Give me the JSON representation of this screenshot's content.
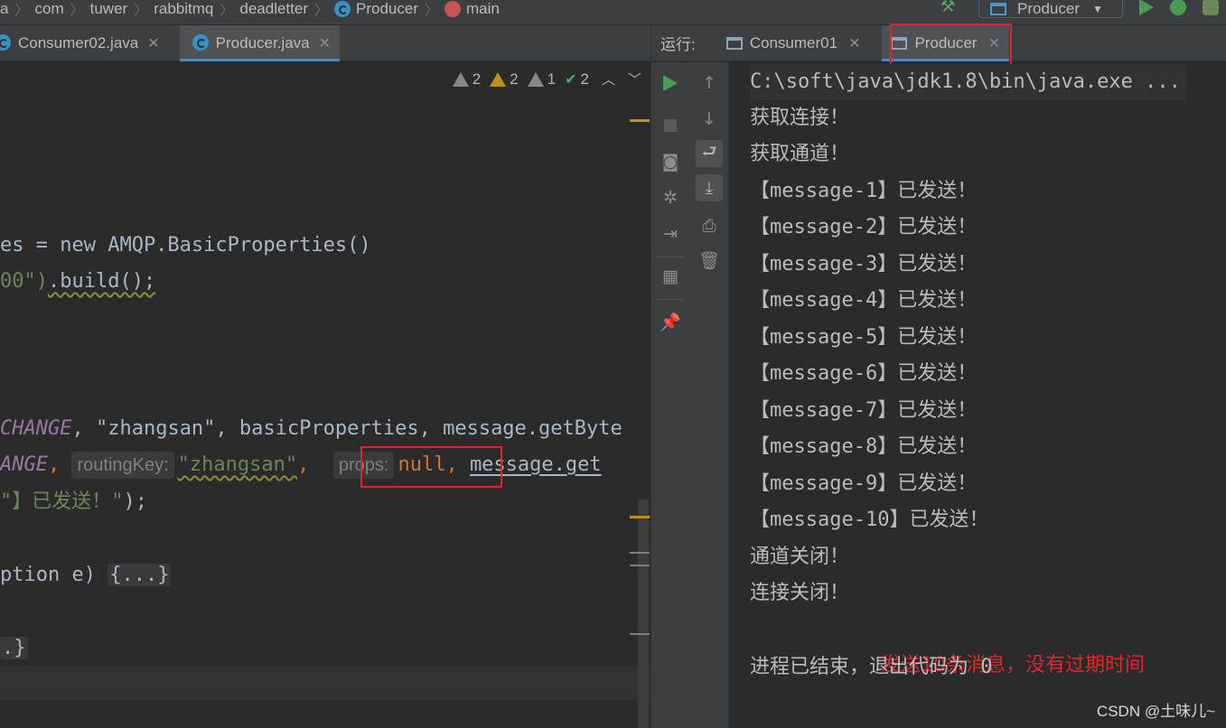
{
  "breadcrumb": {
    "items": [
      "a",
      "com",
      "tuwer",
      "rabbitmq",
      "deadletter",
      "Producer",
      "main"
    ]
  },
  "run_config": {
    "label": "Producer"
  },
  "editor": {
    "tabs": [
      {
        "label": "Consumer02.java",
        "active": false
      },
      {
        "label": "Producer.java",
        "active": true
      }
    ],
    "inspections": [
      {
        "kind": "warning",
        "count": "2"
      },
      {
        "kind": "warning",
        "count": "2"
      },
      {
        "kind": "weak-warning",
        "count": "1"
      },
      {
        "kind": "ok",
        "count": "2"
      }
    ],
    "code": {
      "line1": "es = new AMQP.BasicProperties()",
      "line2a": "00\")",
      "line2b": ".build();",
      "line3_const": "CHANGE",
      "line3_rest": ", \"zhangsan\", basicProperties, message.getByte",
      "line4_const": "ANGE",
      "line4_comma": ", ",
      "line4_hint1": "routingKey:",
      "line4_str": "\"zhangsan\"",
      "line4_comma2": ",  ",
      "line4_hint2": "props:",
      "line4_null": "null",
      "line4_comma3": ",",
      "line4_rest": "message.get",
      "line5_str": "\"】已发送！\"",
      "line5_rest": ");",
      "line6_a": "ption e) ",
      "line6_fold": "{...}",
      "line7": ".}"
    }
  },
  "run_panel": {
    "label": "运行:",
    "tabs": [
      {
        "label": "Consumer01",
        "active": false
      },
      {
        "label": "Producer",
        "active": true
      }
    ],
    "console": [
      "C:\\soft\\java\\jdk1.8\\bin\\java.exe ...",
      "获取连接！",
      "获取通道！",
      "【message-1】已发送！",
      "【message-2】已发送！",
      "【message-3】已发送！",
      "【message-4】已发送！",
      "【message-5】已发送！",
      "【message-6】已发送！",
      "【message-7】已发送！",
      "【message-8】已发送！",
      "【message-9】已发送！",
      "【message-10】已发送！",
      "通道关闭！",
      "连接关闭！"
    ],
    "annotation": "发送10条消息，没有过期时间",
    "exit_message": "进程已结束，退出代码为 0"
  },
  "watermark": "CSDN @土味儿~",
  "colors": {
    "accent": "#4a88c7",
    "highlight_box": "#e0262d",
    "run_green": "#499c54"
  }
}
